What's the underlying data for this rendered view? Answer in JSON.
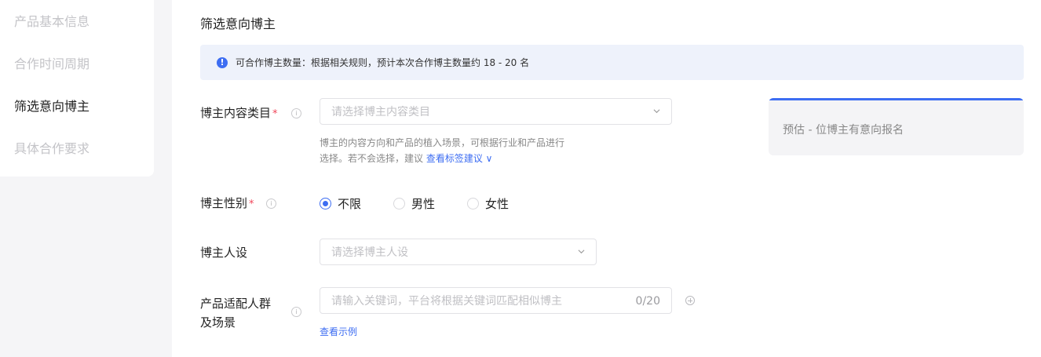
{
  "sidebar": {
    "items": [
      {
        "label": "产品基本信息",
        "active": false
      },
      {
        "label": "合作时间周期",
        "active": false
      },
      {
        "label": "筛选意向博主",
        "active": true
      },
      {
        "label": "具体合作要求",
        "active": false
      }
    ]
  },
  "section": {
    "title": "筛选意向博主",
    "notice": "可合作博主数量：根据相关规则，预计本次合作博主数量约 18 - 20 名",
    "notice_icon": "!"
  },
  "form": {
    "category": {
      "label": "博主内容类目",
      "required_mark": "*",
      "placeholder": "请选择博主内容类目",
      "hint_line1": "博主的内容方向和产品的植入场景，可根据行业和产品进行",
      "hint_line2": "选择。若不会选择，建议 ",
      "hint_link": "查看标签建议 ∨"
    },
    "gender": {
      "label": "博主性别",
      "required_mark": "*",
      "options": [
        "不限",
        "男性",
        "女性"
      ],
      "selected": "不限"
    },
    "persona": {
      "label": "博主人设",
      "placeholder": "请选择博主人设"
    },
    "audience": {
      "label_line1": "产品适配人群",
      "label_line2": "及场景",
      "placeholder": "请输入关键词，平台将根据关键词匹配相似博主",
      "counter": "0/20",
      "example_link": "查看示例"
    }
  },
  "estimate": {
    "text": "预估 - 位博主有意向报名"
  },
  "colors": {
    "accent": "#3d6df2",
    "required": "#f0465a",
    "notice_bg": "#eef2fb"
  }
}
